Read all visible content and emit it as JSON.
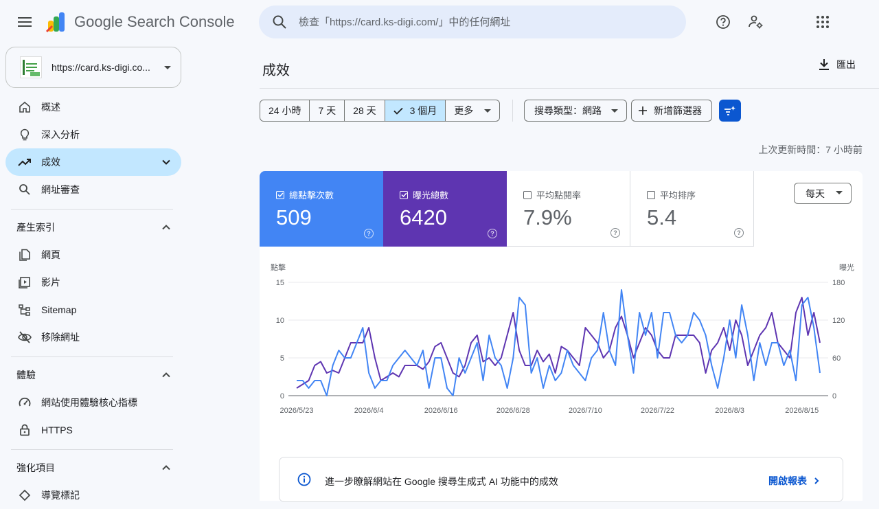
{
  "app": {
    "brand_name": "Google Search Console",
    "search_placeholder": "檢查「https://card.ks-digi.com/」中的任何網址"
  },
  "property": {
    "label": "https://card.ks-digi.co..."
  },
  "sidebar": {
    "items": [
      {
        "label": "概述",
        "icon": "home-icon"
      },
      {
        "label": "深入分析",
        "icon": "lightbulb-icon"
      },
      {
        "label": "成效",
        "icon": "trending-up-icon",
        "active": true
      },
      {
        "label": "網址審查",
        "icon": "search-icon"
      }
    ],
    "sections": [
      {
        "label": "產生索引",
        "items": [
          {
            "label": "網頁",
            "icon": "pages-icon"
          },
          {
            "label": "影片",
            "icon": "video-icon"
          },
          {
            "label": "Sitemap",
            "icon": "sitemap-icon"
          },
          {
            "label": "移除網址",
            "icon": "eye-off-icon"
          }
        ]
      },
      {
        "label": "體驗",
        "items": [
          {
            "label": "網站使用體驗核心指標",
            "icon": "speed-icon"
          },
          {
            "label": "HTTPS",
            "icon": "lock-icon"
          }
        ]
      },
      {
        "label": "強化項目",
        "items": [
          {
            "label": "導覽標記",
            "icon": "diamond-icon"
          }
        ]
      }
    ]
  },
  "page": {
    "title": "成效",
    "export_label": "匯出",
    "updated_text": "上次更新時間：7 小時前"
  },
  "date_ranges": [
    "24 小時",
    "7 天",
    "28 天",
    "3 個月",
    "更多"
  ],
  "selected_range": "3 個月",
  "filters": {
    "search_type": "搜尋類型：網路",
    "add_filter": "新增篩選器"
  },
  "metrics": [
    {
      "label": "總點擊次數",
      "value": "509",
      "checked": true,
      "color": "#4285f4"
    },
    {
      "label": "曝光總數",
      "value": "6420",
      "checked": true,
      "color": "#5e35b1"
    },
    {
      "label": "平均點閱率",
      "value": "7.9%",
      "checked": false,
      "color": "#ffffff"
    },
    {
      "label": "平均排序",
      "value": "5.4",
      "checked": false,
      "color": "#ffffff"
    }
  ],
  "interval": "每天",
  "chart_data": {
    "type": "line",
    "y_left_label": "點擊",
    "y_right_label": "曝光",
    "y_left_ticks": [
      0,
      5,
      10,
      15
    ],
    "y_right_ticks": [
      0,
      60,
      120,
      180
    ],
    "ylim_left": [
      0,
      15
    ],
    "ylim_right": [
      0,
      180
    ],
    "x_tick_labels": [
      "2026/5/23",
      "2026/6/4",
      "2026/6/16",
      "2026/6/28",
      "2026/7/10",
      "2026/7/22",
      "2026/8/3",
      "2026/8/15"
    ],
    "x_tick_indices": [
      0,
      12,
      24,
      36,
      48,
      60,
      72,
      84
    ],
    "series": [
      {
        "name": "點擊",
        "axis": "left",
        "color": "#4285f4",
        "values": [
          2,
          2,
          1,
          2,
          2,
          0,
          4,
          6,
          5,
          5,
          7,
          9,
          3,
          1,
          2,
          2,
          4,
          5,
          6,
          5,
          4,
          6,
          1,
          5,
          5,
          1,
          0,
          5,
          3,
          5,
          7,
          2,
          8,
          5,
          4,
          1,
          5,
          13,
          12,
          3,
          5,
          1,
          4,
          2,
          3,
          6,
          4,
          3,
          2,
          5,
          6,
          11,
          6,
          4,
          14,
          8,
          3,
          11,
          8,
          11,
          5,
          11,
          11,
          8,
          7,
          8,
          11,
          10,
          8,
          4,
          1,
          5,
          10,
          5,
          12,
          8,
          2,
          7,
          4,
          7,
          7,
          4,
          6,
          2,
          12,
          13,
          9,
          3
        ]
      },
      {
        "name": "曝光",
        "axis": "right",
        "color": "#5e35b1",
        "values": [
          12,
          18,
          24,
          48,
          54,
          36,
          40,
          36,
          60,
          84,
          84,
          84,
          108,
          60,
          24,
          30,
          36,
          30,
          48,
          48,
          48,
          42,
          54,
          78,
          84,
          60,
          36,
          30,
          48,
          84,
          96,
          54,
          60,
          48,
          60,
          96,
          132,
          72,
          48,
          48,
          72,
          54,
          66,
          36,
          78,
          72,
          60,
          48,
          108,
          96,
          84,
          60,
          72,
          108,
          126,
          96,
          60,
          84,
          108,
          96,
          72,
          60,
          60,
          96,
          96,
          96,
          96,
          84,
          36,
          72,
          84,
          108,
          72,
          120,
          96,
          48,
          72,
          96,
          108,
          132,
          84,
          72,
          60,
          132,
          156,
          96,
          132,
          84
        ]
      }
    ]
  },
  "ai_banner": {
    "text": "進一步瞭解網站在 Google 搜尋生成式 AI 功能中的成效",
    "link_label": "開啟報表"
  },
  "colors": {
    "accent": "#0b57d0",
    "active_nav": "#c2e7ff",
    "clicks": "#4285f4",
    "impressions": "#5e35b1"
  }
}
